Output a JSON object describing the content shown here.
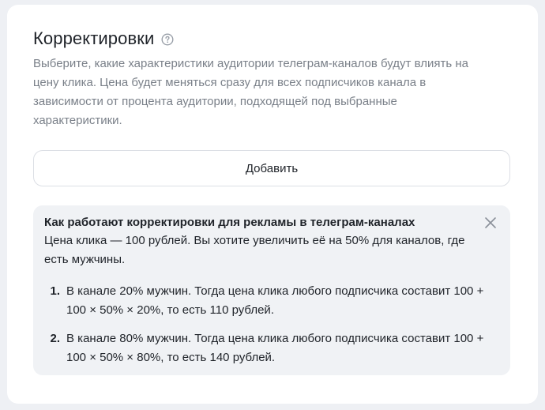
{
  "section": {
    "title": "Корректировки",
    "help_icon": "question-circle-icon",
    "description": "Выберите, какие характеристики аудитории телеграм-каналов будут влиять на цену клика. Цена будет меняться сразу для всех подписчиков канала в зависимости от процента аудитории, подходящей под выбранные характеристики.",
    "add_button_label": "Добавить"
  },
  "info": {
    "title": "Как работают корректировки для рекламы в телеграм-каналах",
    "close_icon": "close-icon",
    "intro": "Цена клика — 100 рублей. Вы хотите увеличить её на 50% для каналов, где есть мужчины.",
    "steps": [
      {
        "number": "1.",
        "text": "В канале 20% мужчин. Тогда цена клика любого подписчика составит 100 + 100 × 50% × 20%, то есть 110 рублей."
      },
      {
        "number": "2.",
        "text": "В канале 80% мужчин. Тогда цена клика любого подписчика составит 100 + 100 × 50% × 80%, то есть 140 рублей."
      }
    ]
  },
  "colors": {
    "page_background": "#eef0f4",
    "card_background": "#ffffff",
    "info_background": "#f0f2f5",
    "muted_text": "#7a8089",
    "main_text": "#1f2329"
  }
}
